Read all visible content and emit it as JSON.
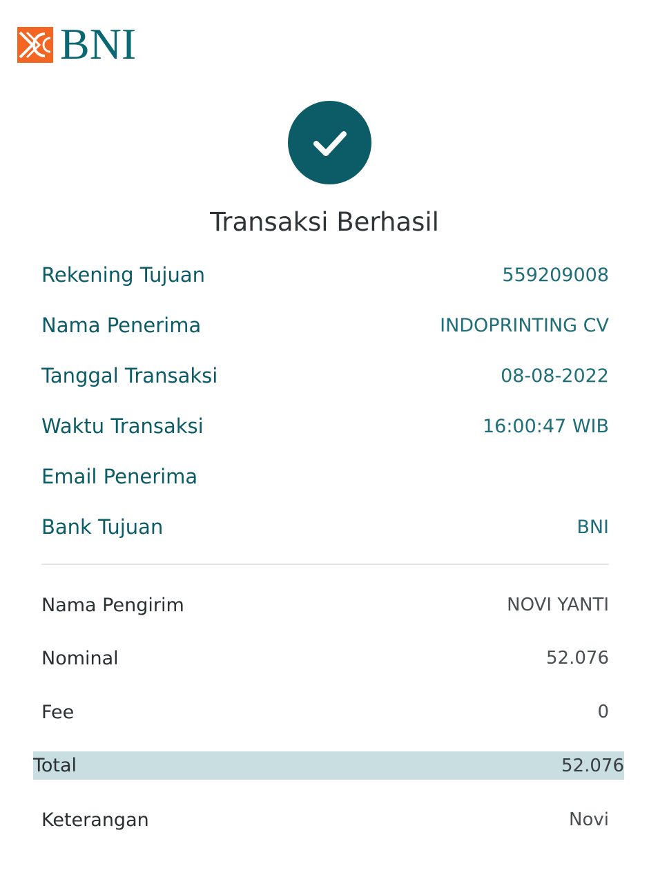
{
  "brand": {
    "name": "BNI",
    "colors": {
      "teal": "#0b5c66",
      "orange": "#f26522",
      "total_band": "#c9dee1"
    }
  },
  "status": {
    "icon": "checkmark-icon",
    "title": "Transaksi Berhasil"
  },
  "recipient": {
    "rows": [
      {
        "label": "Rekening Tujuan",
        "value": "559209008"
      },
      {
        "label": "Nama Penerima",
        "value": "INDOPRINTING CV"
      },
      {
        "label": "Tanggal Transaksi",
        "value": "08-08-2022"
      },
      {
        "label": "Waktu Transaksi",
        "value": "16:00:47 WIB"
      },
      {
        "label": "Email Penerima",
        "value": ""
      },
      {
        "label": "Bank Tujuan",
        "value": "BNI"
      }
    ]
  },
  "sender": {
    "name": {
      "label": "Nama Pengirim",
      "value": "NOVI YANTI"
    },
    "nominal": {
      "label": "Nominal",
      "value": "52.076"
    },
    "fee": {
      "label": "Fee",
      "value": "0"
    },
    "total": {
      "label": "Total",
      "value": "52.076"
    },
    "keterangan": {
      "label": "Keterangan",
      "value": "Novi"
    }
  }
}
